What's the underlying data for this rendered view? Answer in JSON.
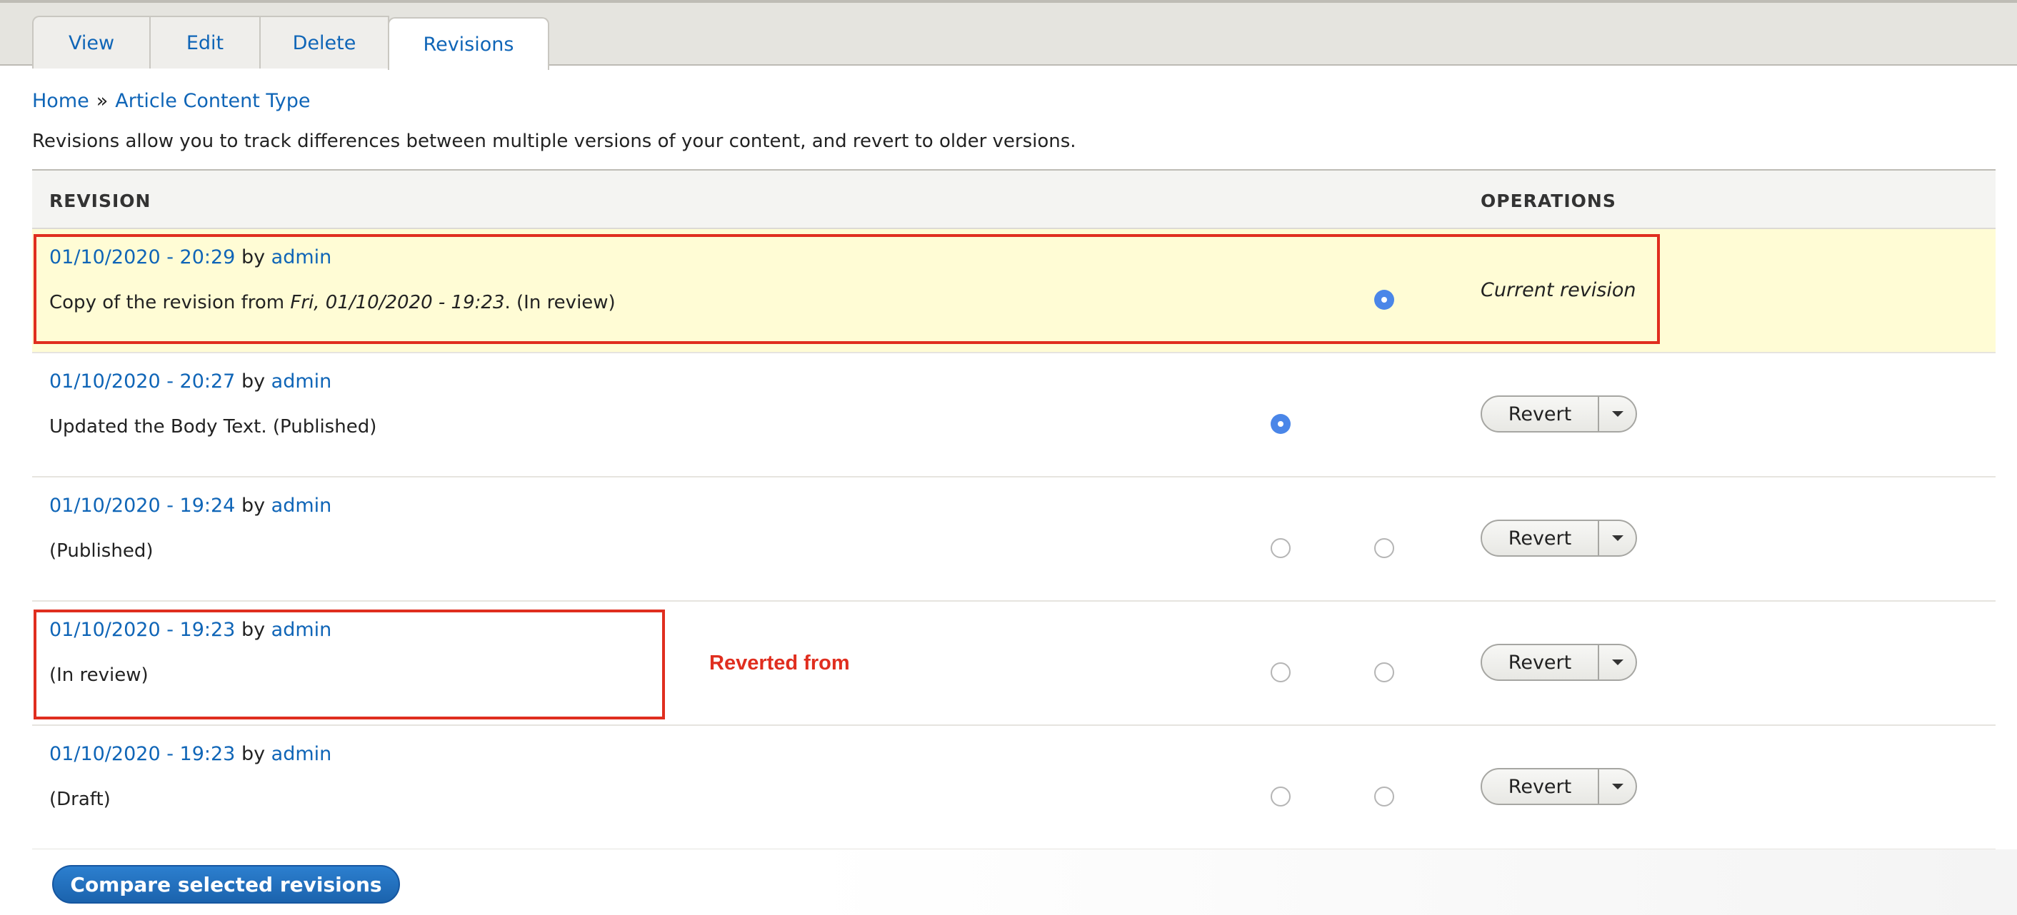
{
  "tabs": [
    {
      "label": "View"
    },
    {
      "label": "Edit"
    },
    {
      "label": "Delete"
    },
    {
      "label": "Revisions",
      "active": true
    }
  ],
  "breadcrumb": {
    "items": [
      "Home",
      "Article Content Type"
    ],
    "separator": "»"
  },
  "intro_text": "Revisions allow you to track differences between multiple versions of your content, and revert to older versions.",
  "table": {
    "headers": {
      "revision": "REVISION",
      "operations": "OPERATIONS"
    },
    "by_word": "by",
    "rows": [
      {
        "date": "01/10/2020 - 20:29",
        "author": "admin",
        "desc_prefix": "Copy of the revision from ",
        "desc_italic": "Fri, 01/10/2020 - 19:23",
        "desc_suffix": ". (In review)",
        "current": true,
        "operation_label": "Current revision"
      },
      {
        "date": "01/10/2020 - 20:27",
        "author": "admin",
        "desc": "Updated the Body Text. (Published)",
        "operation_label": "Revert"
      },
      {
        "date": "01/10/2020 - 19:24",
        "author": "admin",
        "desc": "(Published)",
        "operation_label": "Revert"
      },
      {
        "date": "01/10/2020 - 19:23",
        "author": "admin",
        "desc": "(In review)",
        "operation_label": "Revert"
      },
      {
        "date": "01/10/2020 - 19:23",
        "author": "admin",
        "desc": "(Draft)",
        "operation_label": "Revert"
      }
    ]
  },
  "annotation": {
    "label": "Reverted from",
    "color": "#e02e1f"
  },
  "compare_button": {
    "label": "Compare selected revisions"
  },
  "colors": {
    "link": "#0f65b7",
    "current_row": "#fffcd5",
    "radio_checked": "#4a86e8",
    "primary_button": "#1f6ab5"
  }
}
